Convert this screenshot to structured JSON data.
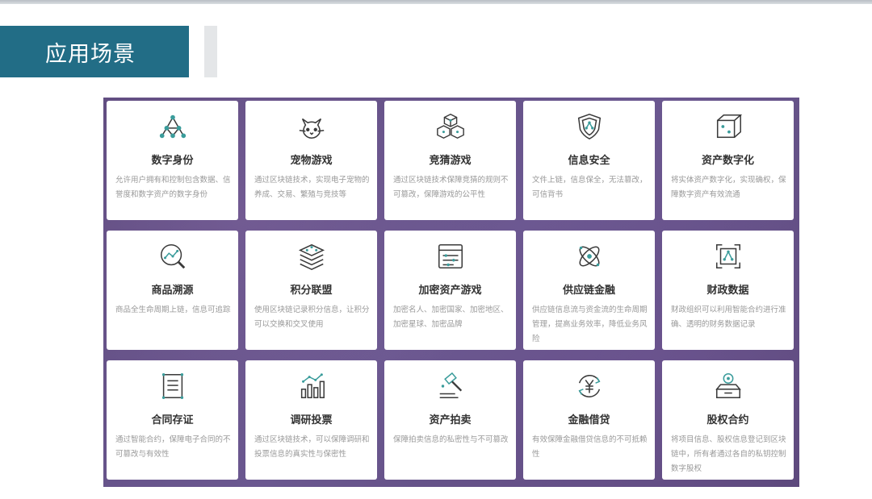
{
  "header": {
    "title": "应用场景"
  },
  "cards": [
    {
      "icon": "network-nodes-icon",
      "title": "数字身份",
      "desc": "允许用户拥有和控制包含数据、信誉度和数字资产的数字身份"
    },
    {
      "icon": "cat-icon",
      "title": "宠物游戏",
      "desc": "通过区块链技术，实现电子宠物的养成、交易、繁殖与竞技等"
    },
    {
      "icon": "cubes-icon",
      "title": "竞猜游戏",
      "desc": "通过区块链技术保障竞猜的规则不可篡改，保障游戏的公平性"
    },
    {
      "icon": "shield-icon",
      "title": "信息安全",
      "desc": "文件上链，信息保全，无法篡改，可信背书"
    },
    {
      "icon": "cube-icon",
      "title": "资产数字化",
      "desc": "将实体资产数字化，实现确权，保障数字资产有效流通"
    },
    {
      "icon": "magnify-trace-icon",
      "title": "商品溯源",
      "desc": "商品全生命周期上链，信息可追踪"
    },
    {
      "icon": "layers-icon",
      "title": "积分联盟",
      "desc": "使用区块链记录积分信息，让积分可以交换和交叉使用"
    },
    {
      "icon": "document-nodes-icon",
      "title": "加密资产游戏",
      "desc": "加密名人、加密国家、加密地区、加密星球、加密品牌"
    },
    {
      "icon": "orbit-icon",
      "title": "供应链金融",
      "desc": "供应链信息流与资金流的生命周期管理，提高业务效率，降低业务风险"
    },
    {
      "icon": "frame-nodes-icon",
      "title": "财政数据",
      "desc": "财政组织可以利用智能合约进行准确、透明的财务数据记录"
    },
    {
      "icon": "contract-icon",
      "title": "合同存证",
      "desc": "通过智能合约，保障电子合同的不可篡改与有效性"
    },
    {
      "icon": "bar-chart-icon",
      "title": "调研投票",
      "desc": "通过区块链技术，可以保障调研和投票信息的真实性与保密性"
    },
    {
      "icon": "gavel-icon",
      "title": "资产拍卖",
      "desc": "保障拍卖信息的私密性与不可篡改"
    },
    {
      "icon": "yen-cycle-icon",
      "title": "金融借贷",
      "desc": "有效保障金融借贷信息的不可抵赖性"
    },
    {
      "icon": "equity-box-icon",
      "title": "股权合约",
      "desc": "将项目信息、股权信息登记到区块链中，所有者通过各自的私钥控制数字股权"
    }
  ],
  "colors": {
    "header_bg": "#226d86",
    "panel_bg": "#5d4a7d",
    "icon_dark": "#3a3a3a",
    "icon_teal": "#3a9c9b"
  }
}
